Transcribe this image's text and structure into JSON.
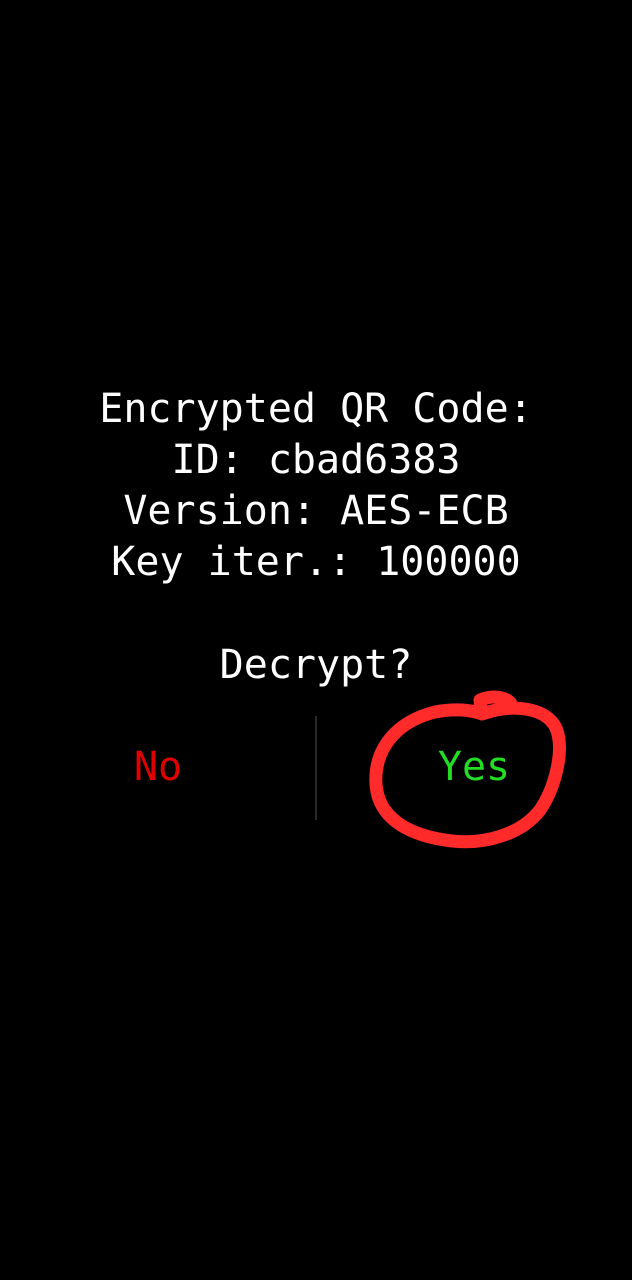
{
  "info": {
    "line1": "Encrypted QR Code:",
    "line2": "ID: cbad6383",
    "line3": "Version: AES-ECB",
    "line4": "Key iter.: 100000"
  },
  "prompt": "Decrypt?",
  "buttons": {
    "no_label": "No",
    "yes_label": "Yes"
  },
  "colors": {
    "background": "#000000",
    "text": "#ffffff",
    "no": "#e00000",
    "yes": "#22dd22",
    "divider": "#2a2a2a",
    "annotation": "#ff2a2a"
  }
}
